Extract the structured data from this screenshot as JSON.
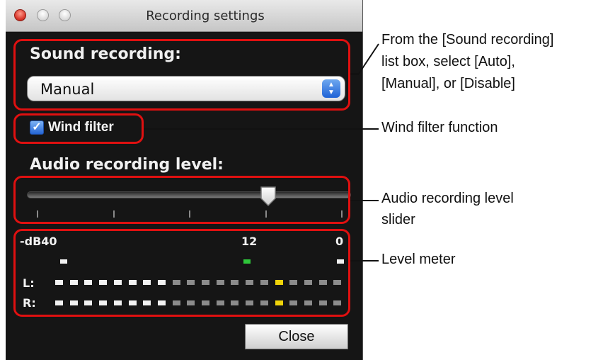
{
  "window": {
    "title": "Recording settings",
    "controls": [
      "close-light-icon",
      "minimize-light-icon",
      "zoom-light-icon"
    ]
  },
  "sound_recording": {
    "label": "Sound recording:",
    "value": "Manual",
    "options_visible": [
      "Manual"
    ]
  },
  "wind_filter": {
    "label": "Wind filter",
    "checked": true
  },
  "audio_level": {
    "label": "Audio recording level:",
    "slider_position": 0.76,
    "tick_count": 5
  },
  "meter": {
    "label_left": "-dB40",
    "label_mid": "12",
    "label_right": "0",
    "channel_l": "L:",
    "channel_r": "R:",
    "lit_segments": 8,
    "total_segments": 20,
    "peak_segment": 15
  },
  "close_button": "Close",
  "annotations": {
    "sound_line1": "From the [Sound recording]",
    "sound_line2": "list box, select [Auto],",
    "sound_line3": "[Manual], or [Disable]",
    "wind": "Wind filter function",
    "slider_line1": "Audio recording level",
    "slider_line2": "slider",
    "meter": "Level meter"
  },
  "colors": {
    "callout": "#e01010",
    "window_bg": "#151515",
    "segment_on": "#f2f2f2",
    "segment_off": "#8c8c8c",
    "segment_peak": "#f0d40a",
    "indicator_mid": "#2ec63a"
  }
}
